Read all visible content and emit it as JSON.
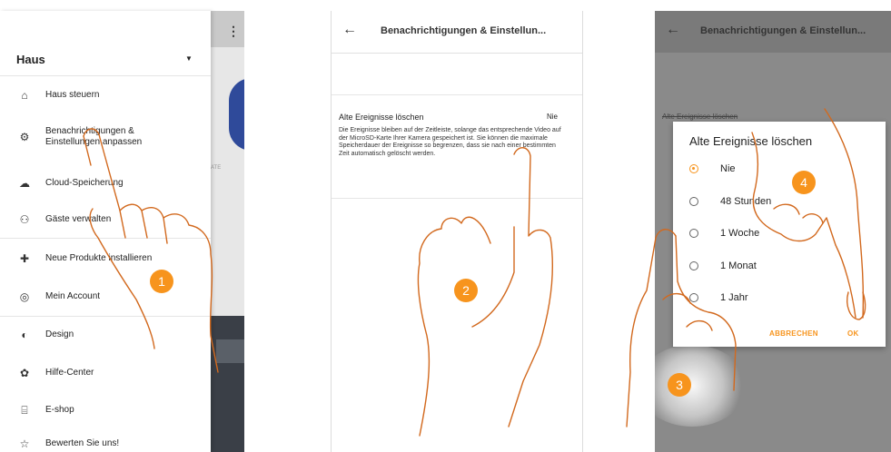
{
  "accent_color": "#f7941d",
  "hand_color": "#d2691e",
  "panel1": {
    "house_title": "Haus",
    "menu": [
      {
        "label": "Haus steuern",
        "icon": "home-icon"
      },
      {
        "label": "Benachrichtigungen & Einstellungen anpassen",
        "icon": "settings-icon"
      },
      {
        "label": "Cloud-Speicherung",
        "icon": "cloud-upload-icon"
      },
      {
        "label": "Gäste verwalten",
        "icon": "guests-icon"
      },
      {
        "label": "Neue Produkte installieren",
        "icon": "plus-icon"
      },
      {
        "label": "Mein Account",
        "icon": "account-icon"
      },
      {
        "label": "Design",
        "icon": "design-icon"
      },
      {
        "label": "Hilfe-Center",
        "icon": "help-icon"
      },
      {
        "label": "E-shop",
        "icon": "shop-icon"
      },
      {
        "label": "Bewerten Sie uns!",
        "icon": "star-icon"
      }
    ],
    "bg_caption": "ATE",
    "callout": "1"
  },
  "panel2": {
    "header_title": "Benachrichtigungen & Einstellun...",
    "setting_title": "Alte Ereignisse löschen",
    "setting_value": "Nie",
    "setting_desc": "Die Ereignisse bleiben auf der Zeitleiste, solange das entsprechende Video auf der MicroSD-Karte Ihrer Kamera gespeichert ist. Sie können die maximale Speicherdauer der Ereignisse so begrenzen, dass sie nach einer bestimmten Zeit automatisch gelöscht werden.",
    "callout": "2"
  },
  "panel3": {
    "header_title": "Benachrichtigungen & Einstellun...",
    "bg_item": "Alte Ereignisse löschen",
    "dialog": {
      "title": "Alte Ereignisse löschen",
      "options": [
        {
          "label": "Nie",
          "selected": true
        },
        {
          "label": "48 Stunden",
          "selected": false
        },
        {
          "label": "1 Woche",
          "selected": false
        },
        {
          "label": "1 Monat",
          "selected": false
        },
        {
          "label": "1 Jahr",
          "selected": false
        }
      ],
      "cancel_label": "ABBRECHEN",
      "ok_label": "OK"
    },
    "callout_3": "3",
    "callout_4": "4"
  }
}
